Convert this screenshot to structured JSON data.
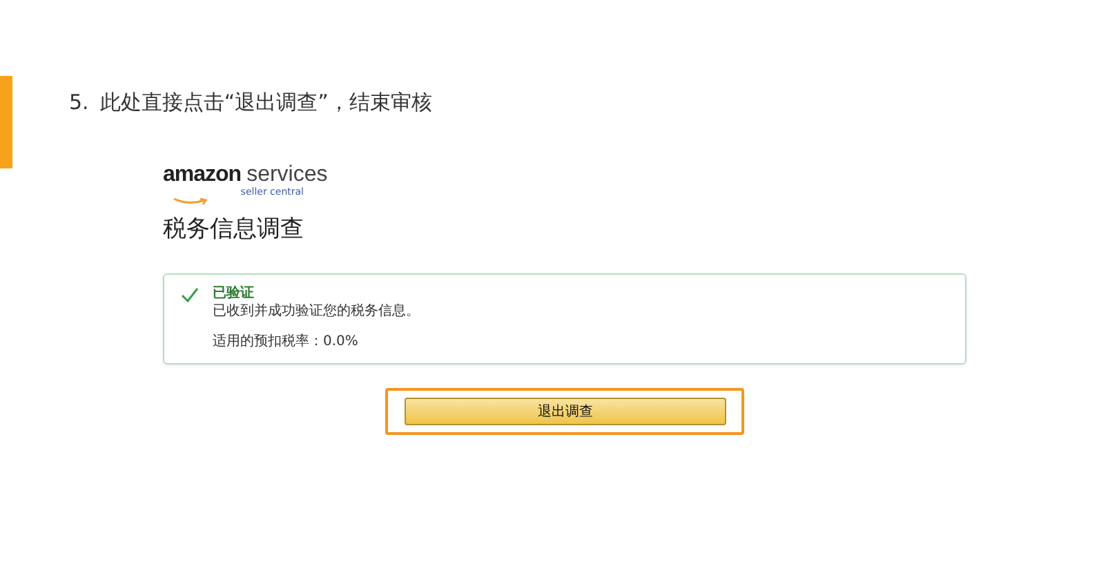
{
  "step": {
    "number": "5.",
    "text": "此处直接点击“退出调查”，结束审核"
  },
  "logo": {
    "brand": "amazon",
    "product": "services",
    "tagline": "seller central"
  },
  "page_title": "税务信息调查",
  "alert": {
    "kind": "success",
    "title": "已验证",
    "message": "已收到并成功验证您的税务信息。",
    "rate_label": "适用的预扣税率：0.0%"
  },
  "button": {
    "label": "退出调查",
    "highlighted": true
  }
}
